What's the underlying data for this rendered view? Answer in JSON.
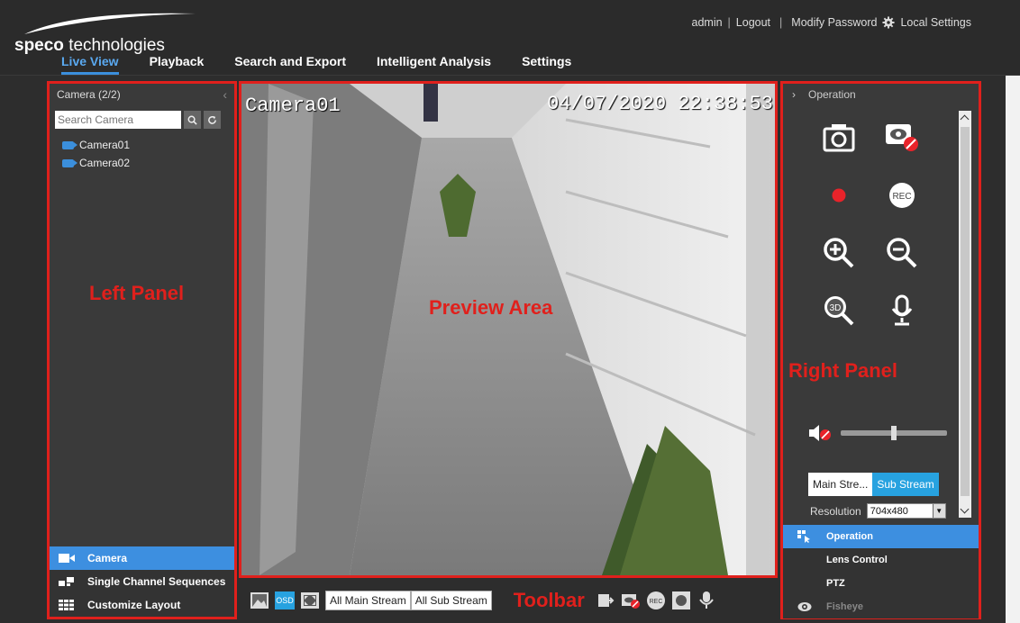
{
  "header": {
    "logo_bold": "speco",
    "logo_rest": " technologies",
    "nav": [
      "Live View",
      "Playback",
      "Search and Export",
      "Intelligent Analysis",
      "Settings"
    ],
    "active_nav": "Live View",
    "user": "admin",
    "sep1": "|",
    "logout": "Logout",
    "sep2": "|",
    "modify_password": "Modify Password",
    "local_settings": "Local Settings"
  },
  "left_panel": {
    "title": "Camera (2/2)",
    "search_placeholder": "Search Camera",
    "cameras": [
      "Camera01",
      "Camera02"
    ],
    "annotation": "Left Panel",
    "menu": [
      "Camera",
      "Single Channel Sequences",
      "Customize Layout"
    ]
  },
  "preview": {
    "osd_name": "Camera01",
    "osd_time": "04/07/2020 22:38:53",
    "annotation": "Preview Area"
  },
  "toolbar": {
    "osd": "OSD",
    "all_main_stream": "All Main Stream",
    "all_sub_stream": "All Sub Stream",
    "annotation": "Toolbar",
    "rec": "REC"
  },
  "right_panel": {
    "title": "Operation",
    "annotation": "Right Panel",
    "rec_label": "REC",
    "zoom3d_label": "3D",
    "main_stream": "Main Stre...",
    "sub_stream": "Sub Stream",
    "resolution_label": "Resolution",
    "resolution_value": "704x480",
    "volume_level": 0.5,
    "menu": [
      "Operation",
      "Lens Control",
      "PTZ",
      "Fisheye"
    ]
  },
  "colors": {
    "accent": "#3d8fe0",
    "annotation_red": "#e0201c",
    "record_red": "#e8232a"
  }
}
